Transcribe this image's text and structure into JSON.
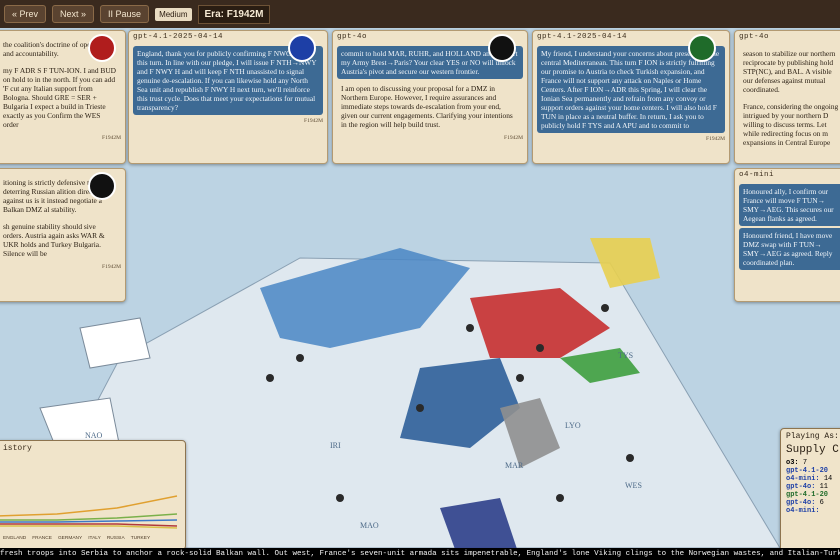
{
  "toolbar": {
    "prev": "« Prev",
    "next": "Next »",
    "pause": "II Pause",
    "speed": "Medium",
    "era": "Era: F1942M"
  },
  "cards": [
    {
      "title": "",
      "avatar_color": "#b01d1d",
      "messages": [
        {
          "dir": "in",
          "text": "the coalition's doctrine of open moves and accountability."
        },
        {
          "dir": "in",
          "text": "my F ADR S F TUN-ION. I and BUD on hold to in the north. If you can add 'F cut any Italian support from Bologna. Should GRE = SER + Bulgaria I expect a build in Trieste exactly as you Confirm the WES order"
        }
      ],
      "ts": "F1942M"
    },
    {
      "title": "gpt-4.1-2025-04-14",
      "avatar_color": "#1d3fa6",
      "messages": [
        {
          "dir": "in",
          "text": "England, thank you for publicly confirming F NWG holds this turn. In line with our pledge, I will issue F NTH→NWY and F NWY H and will keep F NTH unassisted to signal genuine de-escalation. If you can likewise hold any North Sea unit and republish F NWY H next turn, we'll reinforce this trust cycle. Does that meet your expectations for mutual transparency?"
        }
      ],
      "ts": "F1942M"
    },
    {
      "title": "gpt-4o",
      "avatar_color": "#111111",
      "messages": [
        {
          "dir": "out",
          "text": "commit to hold MAR, RUHR, and HOLLAND and support my Army Brest→Paris? Your clear YES or NO will unlock Austria's pivot and secure our western frontier."
        },
        {
          "dir": "in",
          "text": "I am open to discussing your proposal for a DMZ in Northern Europe. However, I require assurances and immediate steps towards de-escalation from your end, given our current engagements. Clarifying your intentions in the region will help build trust."
        }
      ],
      "ts": "F1942M"
    },
    {
      "title": "gpt-4.1-2025-04-14",
      "avatar_color": "#1f6b2a",
      "messages": [
        {
          "dir": "out",
          "text": "My friend, I understand your concerns about presence in the central Mediterranean. This turn F ION is strictly fulfilling our promise to Austria to check Turkish expansion, and France will not support any attack on Naples or Home Centers. After F ION→ADR this Spring, I will clear the Ionian Sea permanently and refrain from any convoy or support orders against your home centers. I will also hold F TUN in place as a neutral buffer. In return, I ask you to publicly hold F TYS and A APU and to commit to"
        }
      ],
      "ts": "F1942M"
    },
    {
      "title": "gpt-4o",
      "avatar_color": "",
      "messages": [
        {
          "dir": "in",
          "text": "season to stabilize our northern reciprocate by publishing hold STP(NC), and BAL. A visible our defenses against mutual coordinated."
        },
        {
          "dir": "in",
          "text": "France, considering the ongoing intrigued by your northern D willing to discuss terms. Let while redirecting focus on m expansions in Central Europe"
        }
      ],
      "ts": ""
    },
    {
      "title": "",
      "avatar_color": "#111111",
      "messages": [
        {
          "dir": "in",
          "text": "itioning is strictly defensive traits and deterring Russian alition directed against us is it instead negotiate a Balkan DMZ al stability."
        },
        {
          "dir": "in",
          "text": "sh genuine stability should sive orders. Austria again asks WAR & UKR holds and Turkey Bulgaria. Silence will be"
        }
      ],
      "ts": "F1942M"
    },
    {
      "title": "o4-mini",
      "avatar_color": "",
      "messages": [
        {
          "dir": "out",
          "text": "Honoured ally, I confirm our France will move F TUN→ SMY→AEG. This secures our Aegean flanks as agreed."
        },
        {
          "dir": "out",
          "text": "Honoured friend, I have move DMZ swap with F TUN→ SMY→AEG as agreed. Reply coordinated plan."
        }
      ],
      "ts": ""
    }
  ],
  "history": {
    "title": "istory",
    "legend": [
      "ENGLAND",
      "FRANCE",
      "GERMANY",
      "ITALY",
      "RUSSIA",
      "TURKEY"
    ],
    "legend_colors": [
      "#6b6b6b",
      "#3c78c8",
      "#b13a3a",
      "#d9c24a",
      "#7ab04a",
      "#e0a030"
    ]
  },
  "playing": {
    "title": "Playing As:",
    "supply_title": "Supply C",
    "rows": [
      {
        "label": "o3:",
        "value": "7",
        "color": "#000000"
      },
      {
        "label": "gpt-4.1-20",
        "value": "",
        "color": "#1d3fa6"
      },
      {
        "label": "o4-mini:",
        "value": "14",
        "color": "#1d3fa6"
      },
      {
        "label": "gpt-4o:",
        "value": "11",
        "color": "#1d3fa6"
      },
      {
        "label": "gpt-4.1-20",
        "value": "",
        "color": "#1f6b2a"
      },
      {
        "label": "gpt-4o:",
        "value": "6",
        "color": "#1d3fa6"
      },
      {
        "label": "o4-mini:",
        "value": "",
        "color": "#1d3fa6"
      }
    ]
  },
  "map_labels": [
    "NAO",
    "IRI",
    "MAO",
    "LYO",
    "TYS",
    "WES",
    "MAR"
  ],
  "ticker": "fresh troops into Serbia to anchor a rock-solid Balkan wall. Out west, France's seven-unit armada sits impenetrable, England's lone Viking clings to the Norwegian wastes, and Italian-Turkish"
}
